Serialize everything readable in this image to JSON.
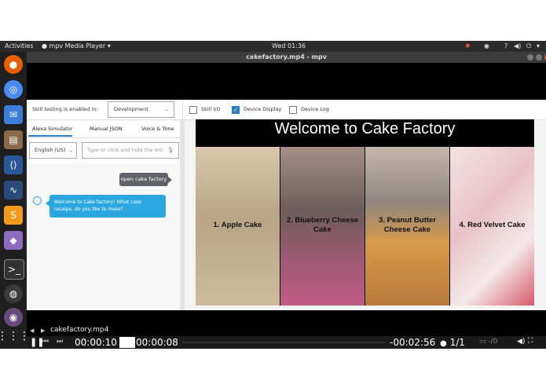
{
  "topbar": {
    "activities": "Activities",
    "app_menu": "mpv Media Player",
    "clock": "Wed 01:36"
  },
  "window": {
    "title": "cakefactory.mp4 - mpv"
  },
  "console": {
    "skill_label": "Skill testing is enabled in:",
    "stage_select": "Development",
    "checkboxes": [
      {
        "label": "Skill I/O",
        "checked": false
      },
      {
        "label": "Device Display",
        "checked": true
      },
      {
        "label": "Device Log",
        "checked": false
      }
    ],
    "tabs": [
      "Alexa Simulator",
      "Manual JSON",
      "Voice & Tone"
    ],
    "locale": "English (US)",
    "input_placeholder": "Type or click and hold the mic",
    "user_msg": "open cake factory",
    "alexa_msg": "Welcome to Cake factory! What cake receipe, do you like to make?"
  },
  "display": {
    "title": "Welcome to Cake Factory",
    "cards": [
      {
        "label": "1. Apple Cake",
        "color": "#c9b79a"
      },
      {
        "label": "2. Blueberry Cheese Cake",
        "color": "#7a5560"
      },
      {
        "label": "3. Peanut Butter Cheese Cake",
        "color": "#c79a5b"
      },
      {
        "label": "4. Red Velvet Cake",
        "color": "#e8b8c0"
      }
    ]
  },
  "player": {
    "filename": "cakefactory.mp4",
    "current": "00:00:10",
    "cache": "00:00:08",
    "remaining": "-00:02:56",
    "playlist": "1/1",
    "sub": "-/0"
  }
}
